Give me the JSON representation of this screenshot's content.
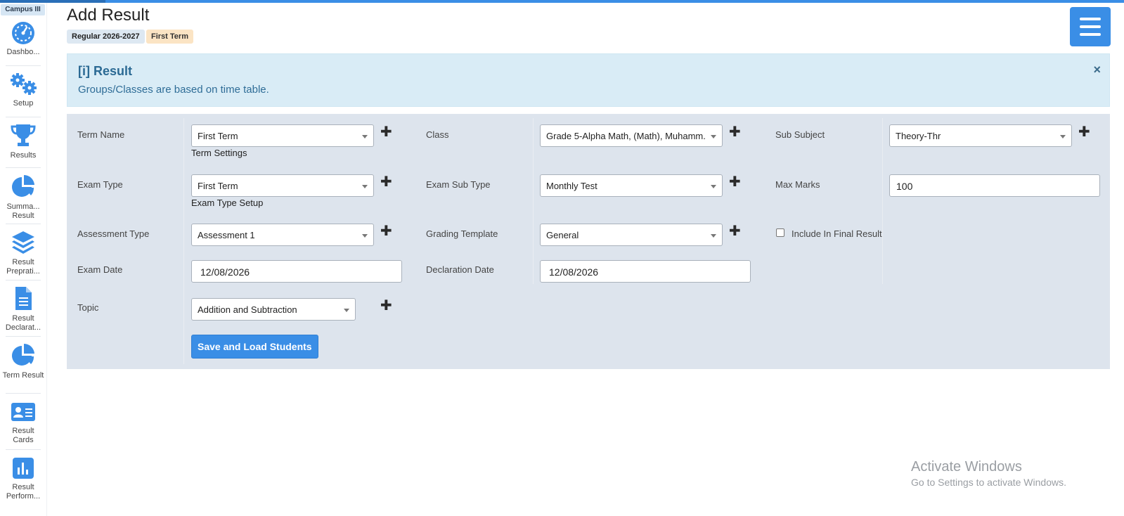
{
  "campus": "Campus III",
  "sidebar": {
    "items": [
      {
        "label": "Dashbo...",
        "icon": "speedometer-icon"
      },
      {
        "label": "Setup",
        "icon": "gears-icon"
      },
      {
        "label": "Results",
        "icon": "trophy-icon"
      },
      {
        "label": "Summa... Result",
        "icon": "pie-chart-icon"
      },
      {
        "label": "Result Preprati...",
        "icon": "layers-icon"
      },
      {
        "label": "Result Declarat...",
        "icon": "document-icon"
      },
      {
        "label": "Term Result",
        "icon": "pie-chart-icon"
      },
      {
        "label": "Result Cards",
        "icon": "id-card-icon"
      },
      {
        "label": "Result Perform...",
        "icon": "bar-chart-icon"
      }
    ]
  },
  "header": {
    "title": "Add Result",
    "session_tag": "Regular 2026-2027",
    "term_tag": "First Term"
  },
  "alert": {
    "title": "[i] Result",
    "text": "Groups/Classes are based on time table.",
    "close": "×"
  },
  "form": {
    "term_name": {
      "label": "Term Name",
      "value": "First Term",
      "link": "Term Settings"
    },
    "class": {
      "label": "Class",
      "value": "Grade 5-Alpha Math, (Math), Muhamm..."
    },
    "sub_subject": {
      "label": "Sub Subject",
      "value": "Theory-Thr"
    },
    "exam_type": {
      "label": "Exam Type",
      "value": "First Term",
      "link": "Exam Type Setup"
    },
    "exam_sub_type": {
      "label": "Exam Sub Type",
      "value": "Monthly Test"
    },
    "max_marks": {
      "label": "Max Marks",
      "value": "100"
    },
    "assessment_type": {
      "label": "Assessment Type",
      "value": "Assessment 1"
    },
    "grading_template": {
      "label": "Grading Template",
      "value": "General"
    },
    "include_final": {
      "label": "Include In Final Result",
      "checked": false
    },
    "exam_date": {
      "label": "Exam Date",
      "value": "12/08/2026"
    },
    "declaration_date": {
      "label": "Declaration Date",
      "value": "12/08/2026"
    },
    "topic": {
      "label": "Topic",
      "value": "Addition and Subtraction"
    },
    "submit_label": "Save and Load Students",
    "plus_glyph": "✚"
  },
  "watermark": {
    "line1": "Activate Windows",
    "line2": "Go to Settings to activate Windows."
  },
  "colors": {
    "accent": "#3a8ee6",
    "panel": "#dde4ed",
    "alert_bg": "#d9ecf6"
  }
}
